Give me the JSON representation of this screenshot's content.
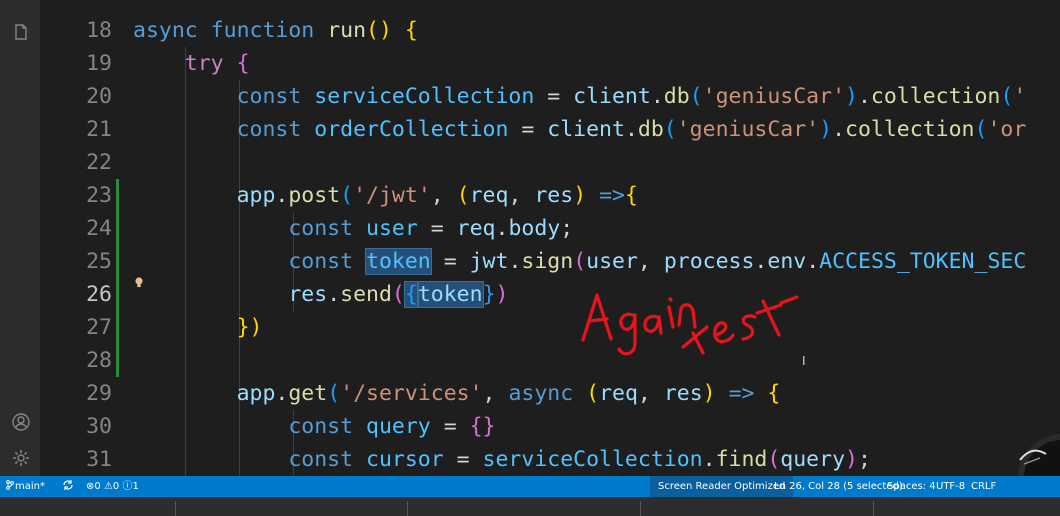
{
  "editor": {
    "lines": [
      {
        "n": "18",
        "active": false,
        "tokens": [
          {
            "t": "async",
            "c": "kw"
          },
          {
            "t": " "
          },
          {
            "t": "function",
            "c": "kw"
          },
          {
            "t": " "
          },
          {
            "t": "run",
            "c": "fn"
          },
          {
            "t": "() ",
            "c": "br1"
          },
          {
            "t": "{",
            "c": "br1"
          }
        ]
      },
      {
        "n": "19",
        "active": false,
        "tokens": [
          {
            "t": "    "
          },
          {
            "t": "try",
            "c": "ctl"
          },
          {
            "t": " "
          },
          {
            "t": "{",
            "c": "br2"
          }
        ]
      },
      {
        "n": "20",
        "active": false,
        "tokens": [
          {
            "t": "        "
          },
          {
            "t": "const",
            "c": "kw"
          },
          {
            "t": " "
          },
          {
            "t": "serviceCollection",
            "c": "const"
          },
          {
            "t": " = "
          },
          {
            "t": "client",
            "c": "var"
          },
          {
            "t": "."
          },
          {
            "t": "db",
            "c": "fn"
          },
          {
            "t": "(",
            "c": "br3"
          },
          {
            "t": "'geniusCar'",
            "c": "str"
          },
          {
            "t": ")",
            "c": "br3"
          },
          {
            "t": "."
          },
          {
            "t": "collection",
            "c": "fn"
          },
          {
            "t": "(",
            "c": "br3"
          },
          {
            "t": "'",
            "c": "str"
          }
        ]
      },
      {
        "n": "21",
        "active": false,
        "tokens": [
          {
            "t": "        "
          },
          {
            "t": "const",
            "c": "kw"
          },
          {
            "t": " "
          },
          {
            "t": "orderCollection",
            "c": "const"
          },
          {
            "t": " = "
          },
          {
            "t": "client",
            "c": "var"
          },
          {
            "t": "."
          },
          {
            "t": "db",
            "c": "fn"
          },
          {
            "t": "(",
            "c": "br3"
          },
          {
            "t": "'geniusCar'",
            "c": "str"
          },
          {
            "t": ")",
            "c": "br3"
          },
          {
            "t": "."
          },
          {
            "t": "collection",
            "c": "fn"
          },
          {
            "t": "(",
            "c": "br3"
          },
          {
            "t": "'or",
            "c": "str"
          }
        ]
      },
      {
        "n": "22",
        "active": false,
        "tokens": []
      },
      {
        "n": "23",
        "active": false,
        "tokens": [
          {
            "t": "        "
          },
          {
            "t": "app",
            "c": "var"
          },
          {
            "t": "."
          },
          {
            "t": "post",
            "c": "fn"
          },
          {
            "t": "(",
            "c": "br3"
          },
          {
            "t": "'/jwt'",
            "c": "str"
          },
          {
            "t": ", "
          },
          {
            "t": "(",
            "c": "br1"
          },
          {
            "t": "req",
            "c": "var"
          },
          {
            "t": ", "
          },
          {
            "t": "res",
            "c": "var"
          },
          {
            "t": ")",
            "c": "br1"
          },
          {
            "t": " "
          },
          {
            "t": "=>",
            "c": "kw"
          },
          {
            "t": "{",
            "c": "br1"
          }
        ]
      },
      {
        "n": "24",
        "active": false,
        "tokens": [
          {
            "t": "            "
          },
          {
            "t": "const",
            "c": "kw"
          },
          {
            "t": " "
          },
          {
            "t": "user",
            "c": "const"
          },
          {
            "t": " = "
          },
          {
            "t": "req",
            "c": "var"
          },
          {
            "t": "."
          },
          {
            "t": "body",
            "c": "var"
          },
          {
            "t": ";"
          }
        ]
      },
      {
        "n": "25",
        "active": false,
        "tokens": [
          {
            "t": "            "
          },
          {
            "t": "const",
            "c": "kw"
          },
          {
            "t": " "
          },
          {
            "t": "token",
            "c": "const hl"
          },
          {
            "t": " = "
          },
          {
            "t": "jwt",
            "c": "var"
          },
          {
            "t": "."
          },
          {
            "t": "sign",
            "c": "fn"
          },
          {
            "t": "(",
            "c": "br2"
          },
          {
            "t": "user",
            "c": "var"
          },
          {
            "t": ", "
          },
          {
            "t": "process",
            "c": "var"
          },
          {
            "t": "."
          },
          {
            "t": "env",
            "c": "var"
          },
          {
            "t": "."
          },
          {
            "t": "ACCESS_TOKEN_SEC",
            "c": "const"
          }
        ]
      },
      {
        "n": "26",
        "active": true,
        "tokens": [
          {
            "t": "            "
          },
          {
            "t": "res",
            "c": "var"
          },
          {
            "t": "."
          },
          {
            "t": "send",
            "c": "fn"
          },
          {
            "t": "(",
            "c": "br2"
          },
          {
            "t": "{",
            "c": "br3 hl"
          },
          {
            "t": "token",
            "c": "var hl"
          },
          {
            "t": "}",
            "c": "br3"
          },
          {
            "t": ")",
            "c": "br2"
          }
        ]
      },
      {
        "n": "27",
        "active": false,
        "tokens": [
          {
            "t": "        "
          },
          {
            "t": "})",
            "c": "br1"
          }
        ]
      },
      {
        "n": "28",
        "active": false,
        "tokens": []
      },
      {
        "n": "29",
        "active": false,
        "tokens": [
          {
            "t": "        "
          },
          {
            "t": "app",
            "c": "var"
          },
          {
            "t": "."
          },
          {
            "t": "get",
            "c": "fn"
          },
          {
            "t": "(",
            "c": "br3"
          },
          {
            "t": "'/services'",
            "c": "str"
          },
          {
            "t": ", "
          },
          {
            "t": "async",
            "c": "kw"
          },
          {
            "t": " "
          },
          {
            "t": "(",
            "c": "br1"
          },
          {
            "t": "req",
            "c": "var"
          },
          {
            "t": ", "
          },
          {
            "t": "res",
            "c": "var"
          },
          {
            "t": ")",
            "c": "br1"
          },
          {
            "t": " "
          },
          {
            "t": "=>",
            "c": "kw"
          },
          {
            "t": " "
          },
          {
            "t": "{",
            "c": "br1"
          }
        ]
      },
      {
        "n": "30",
        "active": false,
        "tokens": [
          {
            "t": "            "
          },
          {
            "t": "const",
            "c": "kw"
          },
          {
            "t": " "
          },
          {
            "t": "query",
            "c": "const"
          },
          {
            "t": " = "
          },
          {
            "t": "{}",
            "c": "br2"
          }
        ]
      },
      {
        "n": "31",
        "active": false,
        "tokens": [
          {
            "t": "            "
          },
          {
            "t": "const",
            "c": "kw"
          },
          {
            "t": " "
          },
          {
            "t": "cursor",
            "c": "const"
          },
          {
            "t": " = "
          },
          {
            "t": "serviceCollection",
            "c": "const"
          },
          {
            "t": "."
          },
          {
            "t": "find",
            "c": "fn"
          },
          {
            "t": "(",
            "c": "br2"
          },
          {
            "t": "query",
            "c": "var"
          },
          {
            "t": ")",
            "c": "br2"
          },
          {
            "t": ";"
          }
        ]
      }
    ]
  },
  "annotation": {
    "text": "Again test",
    "color": "#e8141b"
  },
  "status_bar": {
    "branch": "main*",
    "errors": "0",
    "warnings": "0",
    "info": "1",
    "screen_reader": "Screen Reader Optimized",
    "cursor_position": "Ln 26, Col 28 (5 selected)",
    "spaces": "Spaces: 4",
    "encoding": "UTF-8",
    "eol": "CRLF"
  },
  "icons": {
    "activity_top": "files-icon",
    "activity_account": "account-icon",
    "activity_settings": "gear-icon",
    "status_branch": "source-control-icon",
    "status_sync": "sync-icon",
    "lightbulb": "lightbulb-icon"
  },
  "colors": {
    "status_bar": "#007acc",
    "editor_bg": "#1e1e1e",
    "git_added": "#2ea043"
  }
}
